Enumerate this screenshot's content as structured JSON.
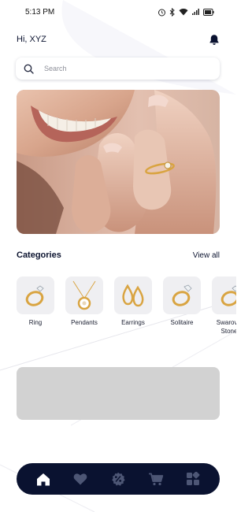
{
  "status_bar": {
    "time": "5:13 PM"
  },
  "header": {
    "greeting": "Hi, XYZ"
  },
  "search": {
    "placeholder": "Search",
    "value": ""
  },
  "categories": {
    "title": "Categories",
    "view_all_label": "View all",
    "items": [
      {
        "label": "Ring",
        "icon": "ring-icon"
      },
      {
        "label": "Pendants",
        "icon": "pendant-icon"
      },
      {
        "label": "Earrings",
        "icon": "earrings-icon"
      },
      {
        "label": "Solitaire",
        "icon": "solitaire-icon"
      },
      {
        "label": "Swarovski Stones",
        "icon": "ring-icon"
      }
    ]
  },
  "bottom_nav": {
    "items": [
      {
        "name": "home",
        "icon": "home-icon",
        "active": true
      },
      {
        "name": "favorites",
        "icon": "heart-icon",
        "active": false
      },
      {
        "name": "offers",
        "icon": "discount-icon",
        "active": false
      },
      {
        "name": "cart",
        "icon": "cart-icon",
        "active": false
      },
      {
        "name": "more",
        "icon": "grid-icon",
        "active": false
      }
    ]
  },
  "colors": {
    "primary": "#0a1230",
    "nav_inactive": "#4d5675",
    "tile_bg": "#efeff2",
    "placeholder": "#d2d2d2",
    "gold": "#d9a441"
  }
}
